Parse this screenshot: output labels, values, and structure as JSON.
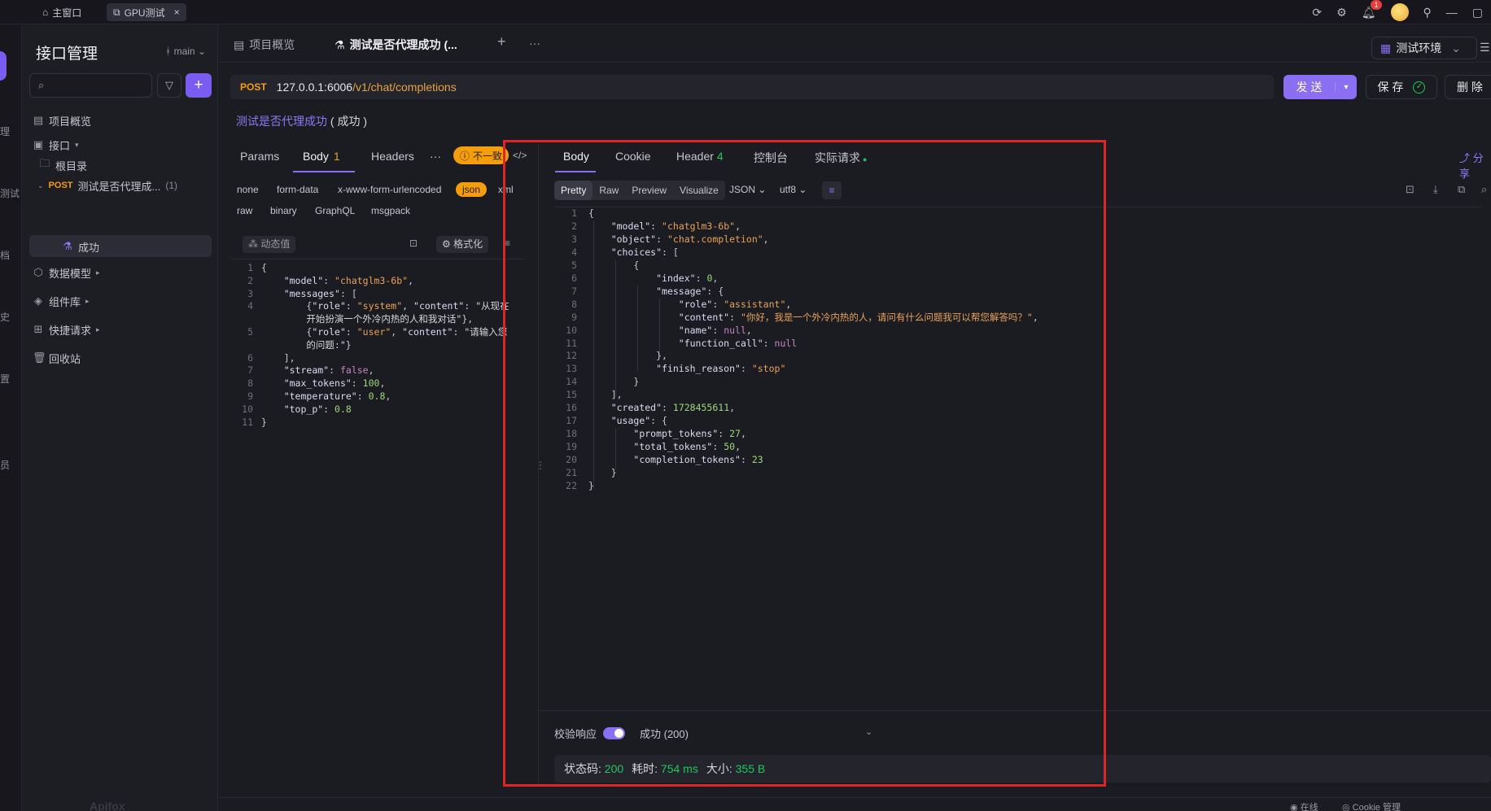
{
  "titlebar": {
    "tabs": [
      {
        "label": "主窗口",
        "icon": "home-icon"
      },
      {
        "label": "GPU测试",
        "icon": "project-icon",
        "close": "×"
      }
    ],
    "notification_count": "1"
  },
  "rail": {
    "labels": [
      "理",
      "测试",
      "档",
      "史",
      "置",
      "员"
    ]
  },
  "sidebar": {
    "title": "接口管理",
    "branch": "main",
    "search_placeholder": "",
    "add_label": "+",
    "items": [
      {
        "label": "项目概览"
      },
      {
        "label": "接口"
      },
      {
        "label": "根目录"
      },
      {
        "method": "POST",
        "label": "测试是否代理成...",
        "count": "(1)"
      },
      {
        "label": "成功"
      },
      {
        "label": "数据模型"
      },
      {
        "label": "组件库"
      },
      {
        "label": "快捷请求"
      },
      {
        "label": "回收站"
      }
    ]
  },
  "doc_tabs": [
    {
      "label": "项目概览"
    },
    {
      "label": "测试是否代理成功 (..."
    }
  ],
  "doc_tab_add": "+",
  "doc_tab_more": "···",
  "environment": "测试环境",
  "request": {
    "method": "POST",
    "host": "127.0.0.1:6006",
    "path": "/v1/chat/completions",
    "send": "发 送",
    "save": "保 存",
    "delete": "删 除",
    "case_name": "测试是否代理成功",
    "case_status": "( 成功 )"
  },
  "req_tabs": [
    {
      "label": "Params"
    },
    {
      "label": "Body",
      "count": "1"
    },
    {
      "label": "Headers"
    },
    {
      "label": "···"
    }
  ],
  "warning": "不一致",
  "body_types_row1": [
    "none",
    "form-data",
    "x-www-form-urlencoded",
    "json",
    "xml"
  ],
  "body_types_row2": [
    "raw",
    "binary",
    "GraphQL",
    "msgpack"
  ],
  "editor_toolbar": {
    "dynamic": "动态值",
    "format": "格式化"
  },
  "request_body_lines": [
    {
      "n": "1",
      "t": "{"
    },
    {
      "n": "2",
      "t": "    \"model\": \"chatglm3-6b\","
    },
    {
      "n": "3",
      "t": "    \"messages\": ["
    },
    {
      "n": "4",
      "t": "        {\"role\": \"system\", \"content\": \"从现在"
    },
    {
      "n": "",
      "t": "        开始扮演一个外冷内热的人和我对话\"},"
    },
    {
      "n": "5",
      "t": "        {\"role\": \"user\", \"content\": \"请输入您"
    },
    {
      "n": "",
      "t": "        的问题:\"}"
    },
    {
      "n": "6",
      "t": "    ],"
    },
    {
      "n": "7",
      "t": "    \"stream\": false,"
    },
    {
      "n": "8",
      "t": "    \"max_tokens\": 100,"
    },
    {
      "n": "9",
      "t": "    \"temperature\": 0.8,"
    },
    {
      "n": "10",
      "t": "    \"top_p\": 0.8"
    },
    {
      "n": "11",
      "t": "}"
    }
  ],
  "resp_tabs": [
    {
      "label": "Body"
    },
    {
      "label": "Cookie"
    },
    {
      "label": "Header",
      "count": "4"
    },
    {
      "label": "控制台"
    },
    {
      "label": "实际请求",
      "dot": "●"
    }
  ],
  "share": "分享",
  "formats": [
    "Pretty",
    "Raw",
    "Preview",
    "Visualize"
  ],
  "format_select": "JSON",
  "encoding_select": "utf8",
  "response_lines": [
    {
      "n": "1",
      "t": "{"
    },
    {
      "n": "2",
      "t": "    \"model\": \"chatglm3-6b\","
    },
    {
      "n": "3",
      "t": "    \"object\": \"chat.completion\","
    },
    {
      "n": "4",
      "t": "    \"choices\": ["
    },
    {
      "n": "5",
      "t": "        {"
    },
    {
      "n": "6",
      "t": "            \"index\": 0,"
    },
    {
      "n": "7",
      "t": "            \"message\": {"
    },
    {
      "n": "8",
      "t": "                \"role\": \"assistant\","
    },
    {
      "n": "9",
      "t": "                \"content\": \"你好，我是一个外冷内热的人，请问有什么问题我可以帮您解答吗？\","
    },
    {
      "n": "10",
      "t": "                \"name\": null,"
    },
    {
      "n": "11",
      "t": "                \"function_call\": null"
    },
    {
      "n": "12",
      "t": "            },"
    },
    {
      "n": "13",
      "t": "            \"finish_reason\": \"stop\""
    },
    {
      "n": "14",
      "t": "        }"
    },
    {
      "n": "15",
      "t": "    ],"
    },
    {
      "n": "16",
      "t": "    \"created\": 1728455611,"
    },
    {
      "n": "17",
      "t": "    \"usage\": {"
    },
    {
      "n": "18",
      "t": "        \"prompt_tokens\": 27,"
    },
    {
      "n": "19",
      "t": "        \"total_tokens\": 50,"
    },
    {
      "n": "20",
      "t": "        \"completion_tokens\": 23"
    },
    {
      "n": "21",
      "t": "    }"
    },
    {
      "n": "22",
      "t": "}"
    }
  ],
  "validation": {
    "label": "校验响应",
    "result": "成功 (200)"
  },
  "status": {
    "code_label": "状态码:",
    "code": "200",
    "time_label": "耗时:",
    "time": "754 ms",
    "size_label": "大小:",
    "size": "355 B"
  },
  "footer": {
    "online": "在线",
    "cookie": "Cookie 管理",
    "brand": "Apifox"
  },
  "colors": {
    "accent": "#8b6ff2",
    "post": "#f59e0b",
    "success": "#22c55e",
    "highlight": "#e02424"
  }
}
